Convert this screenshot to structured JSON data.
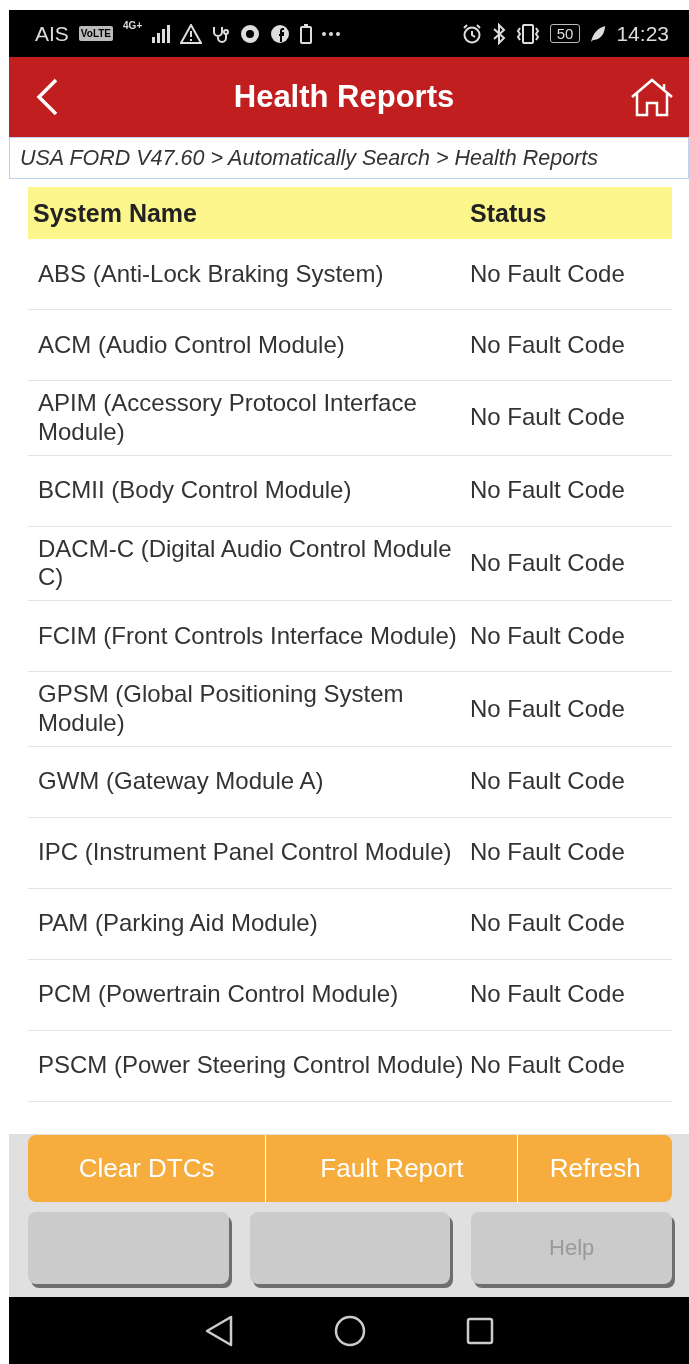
{
  "status_bar": {
    "carrier": "AIS",
    "volte": "VoLTE",
    "network": "4G+",
    "battery": "50",
    "time": "14:23"
  },
  "header": {
    "title": "Health Reports"
  },
  "breadcrumb": "USA FORD V47.60 > Automatically Search > Health Reports",
  "table": {
    "columns": [
      "System Name",
      "Status"
    ],
    "rows": [
      {
        "name": "ABS (Anti-Lock Braking System)",
        "status": "No Fault Code"
      },
      {
        "name": "ACM (Audio Control Module)",
        "status": "No Fault Code"
      },
      {
        "name": "APIM (Accessory Protocol Interface Module)",
        "status": "No Fault Code"
      },
      {
        "name": "BCMII (Body Control Module)",
        "status": "No Fault Code"
      },
      {
        "name": "DACM-C (Digital Audio Control Module C)",
        "status": "No Fault Code"
      },
      {
        "name": "FCIM (Front Controls Interface Module)",
        "status": "No Fault Code"
      },
      {
        "name": "GPSM (Global Positioning System Module)",
        "status": "No Fault Code"
      },
      {
        "name": "GWM (Gateway Module A)",
        "status": "No Fault Code"
      },
      {
        "name": "IPC (Instrument Panel Control Module)",
        "status": "No Fault Code"
      },
      {
        "name": "PAM (Parking Aid Module)",
        "status": "No Fault Code"
      },
      {
        "name": "PCM (Powertrain Control Module)",
        "status": "No Fault Code"
      },
      {
        "name": "PSCM (Power Steering Control Module)",
        "status": "No Fault Code"
      }
    ]
  },
  "action_buttons": [
    "Clear DTCs",
    "Fault Report",
    "Refresh"
  ],
  "secondary_buttons": [
    {
      "kind": "blank"
    },
    {
      "kind": "blank"
    },
    {
      "kind": "help",
      "label": "Help"
    }
  ]
}
